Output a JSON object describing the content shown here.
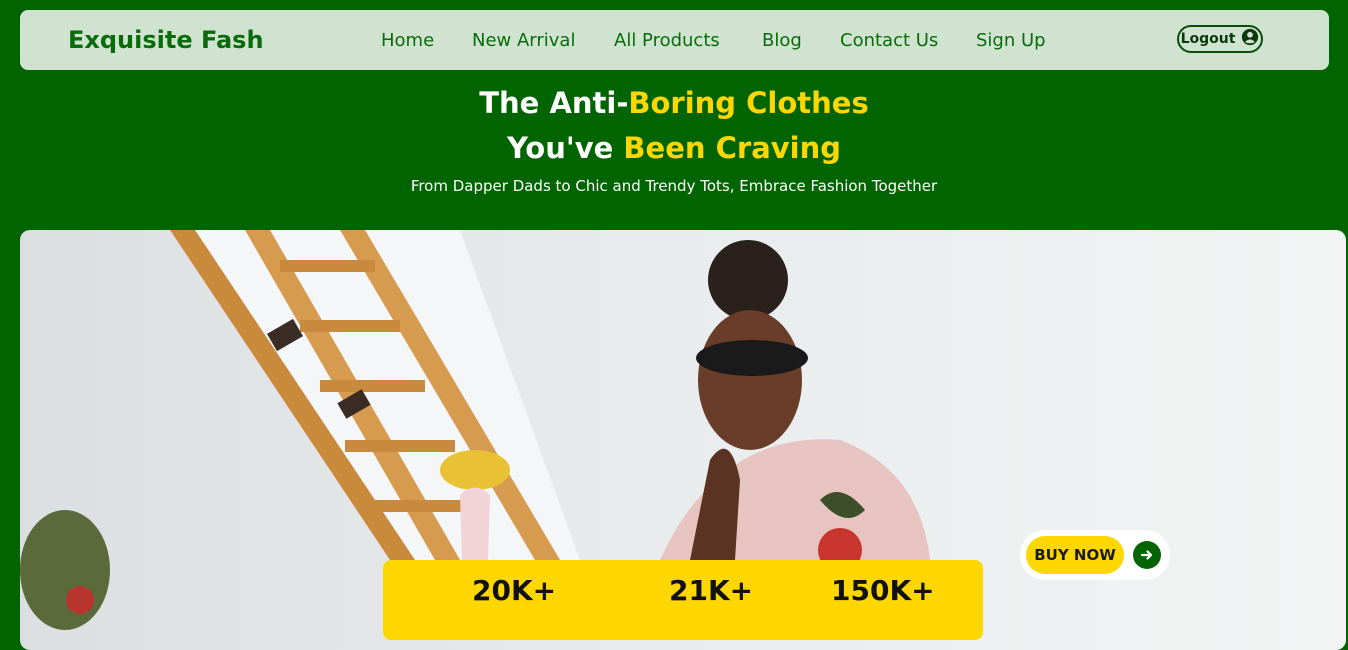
{
  "brand": "Exquisite Fash",
  "nav": {
    "items": [
      {
        "label": "Home"
      },
      {
        "label": "New Arrival"
      },
      {
        "label": "All Products"
      },
      {
        "label": "Blog"
      },
      {
        "label": "Contact Us"
      },
      {
        "label": "Sign Up"
      }
    ],
    "logout_label": "Logout"
  },
  "hero": {
    "line1_a": "The Anti-",
    "line1_b": "Boring Clothes",
    "line2_a": "You've ",
    "line2_b": "Been Craving",
    "subtitle": "From Dapper Dads to Chic and Trendy Tots, Embrace Fashion Together"
  },
  "cta": {
    "buy_now_label": "BUY NOW"
  },
  "stats": [
    {
      "value": "20K+"
    },
    {
      "value": "21K+"
    },
    {
      "value": "150K+"
    }
  ],
  "colors": {
    "background": "#006400",
    "navbar": "#d0e3d0",
    "accent": "#ffd700"
  }
}
